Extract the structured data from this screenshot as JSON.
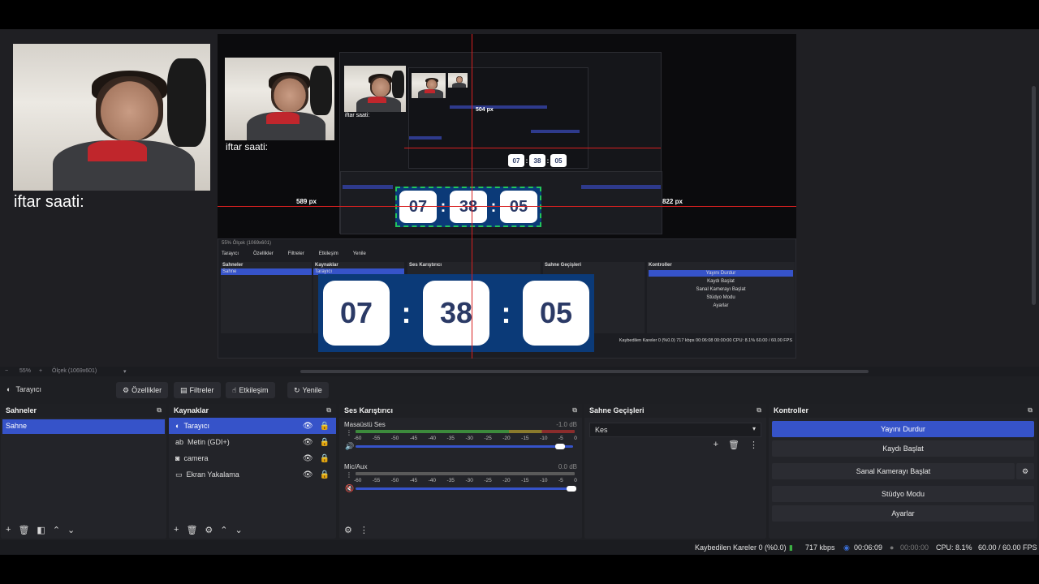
{
  "preview": {
    "overlay_text": "iftar saati:",
    "clock": {
      "hours": "07",
      "minutes": "38",
      "seconds": "05",
      "separator": ":"
    },
    "guide_left_px": "589 px",
    "guide_right_px": "822 px",
    "guide_top_px": "504 px",
    "mini": {
      "sahneler": "Sahneler",
      "sahne": "Sahne",
      "kaynaklar": "Kaynaklar",
      "tarayici": "Tarayıcı",
      "ses": "Ses Karıştırıcı",
      "gecisler": "Sahne Geçişleri",
      "kontroller": "Kontroller",
      "yayini_durdur": "Yayını Durdur",
      "kaydi_baslat": "Kaydı Başlat",
      "sanal": "Sanal Kamerayı Başlat",
      "studyo": "Stüdyo Modu",
      "ayarlar": "Ayarlar",
      "ozellikler": "Özellikler",
      "filtreler": "Filtreler",
      "etkilesim": "Etkileşim",
      "yenile": "Yenile",
      "status": "Kaybedilen Kareler 0 (%0.0)   717 kbps   00:06:08   00:00:00   CPU: 8.1%   60.00 / 60.00 FPS",
      "zoom": "55%   Ölçek (1069x601)"
    }
  },
  "zoombar": {
    "zoom": "55%",
    "scale": "Ölçek (1069x601)"
  },
  "source_toolbar": {
    "source": "Tarayıcı",
    "buttons": {
      "properties": "Özellikler",
      "filters": "Filtreler",
      "interact": "Etkileşim",
      "refresh": "Yenile"
    }
  },
  "docks": {
    "scenes": {
      "title": "Sahneler",
      "items": [
        "Sahne"
      ]
    },
    "sources": {
      "title": "Kaynaklar",
      "items": [
        {
          "name": "Tarayıcı",
          "icon": "globe-icon"
        },
        {
          "name": "Metin (GDI+)",
          "icon": "text-icon"
        },
        {
          "name": "camera",
          "icon": "camera-icon"
        },
        {
          "name": "Ekran Yakalama",
          "icon": "monitor-icon"
        }
      ]
    },
    "mixer": {
      "title": "Ses Karıştırıcı",
      "channels": [
        {
          "name": "Masaüstü Ses",
          "db": "-1.0 dB"
        },
        {
          "name": "Mic/Aux",
          "db": "0.0 dB"
        }
      ],
      "ticks": [
        "-60",
        "-55",
        "-50",
        "-45",
        "-40",
        "-35",
        "-30",
        "-25",
        "-20",
        "-15",
        "-10",
        "-5",
        "0"
      ]
    },
    "transitions": {
      "title": "Sahne Geçişleri",
      "selected": "Kes"
    },
    "controls": {
      "title": "Kontroller",
      "stop_stream": "Yayını Durdur",
      "start_record": "Kaydı Başlat",
      "virtual_cam": "Sanal Kamerayı Başlat",
      "studio_mode": "Stüdyo Modu",
      "settings": "Ayarlar"
    }
  },
  "status": {
    "dropped": "Kaybedilen Kareler 0 (%0.0)",
    "bitrate": "717 kbps",
    "stream_time": "00:06:09",
    "record_time": "00:00:00",
    "cpu": "CPU: 8.1%",
    "fps": "60.00 / 60.00 FPS"
  },
  "colors": {
    "accent": "#3653c9",
    "panel": "#232429",
    "guide": "#d82020",
    "clock_bg": "#0b3a78"
  }
}
